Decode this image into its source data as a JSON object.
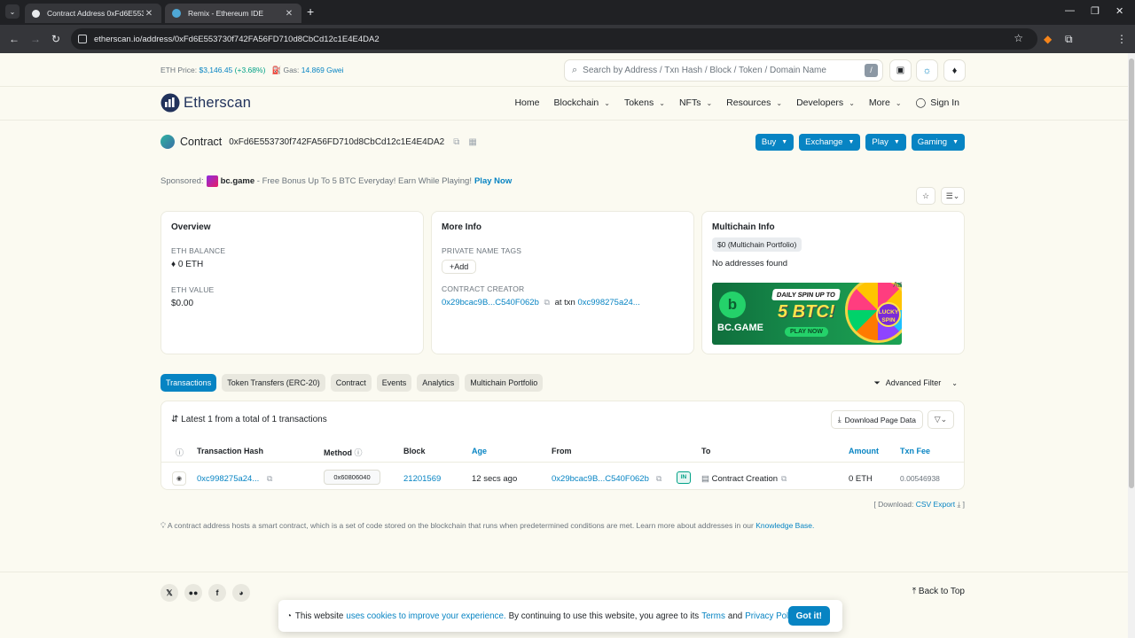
{
  "browser": {
    "tabs": [
      {
        "title": "Contract Address 0xFd6E55373",
        "active": true
      },
      {
        "title": "Remix - Ethereum IDE",
        "active": false
      }
    ],
    "url": "etherscan.io/address/0xFd6E553730f742FA56FD710d8CbCd12c1E4E4DA2"
  },
  "topbar": {
    "eth_price_label": "ETH Price:",
    "eth_price": "$3,146.45",
    "eth_change": "(+3.68%)",
    "gas_label": "Gas:",
    "gas_value": "14.869 Gwei",
    "search_placeholder": "Search by Address / Txn Hash / Block / Token / Domain Name",
    "search_shortcut": "/"
  },
  "header": {
    "logo_text": "Etherscan",
    "nav": [
      "Home",
      "Blockchain",
      "Tokens",
      "NFTs",
      "Resources",
      "Developers",
      "More"
    ],
    "signin": "Sign In"
  },
  "contract": {
    "label": "Contract",
    "address": "0xFd6E553730f742FA56FD710d8CbCd12c1E4E4DA2",
    "actions": [
      "Buy",
      "Exchange",
      "Play",
      "Gaming"
    ]
  },
  "sponsored": {
    "label": "Sponsored:",
    "brand": "bc.game",
    "text": "- Free Bonus Up To 5 BTC Everyday! Earn While Playing!",
    "cta": "Play Now"
  },
  "overview": {
    "title": "Overview",
    "eth_balance_label": "ETH BALANCE",
    "eth_balance": "0 ETH",
    "eth_value_label": "ETH VALUE",
    "eth_value": "$0.00"
  },
  "more_info": {
    "title": "More Info",
    "private_tags_label": "PRIVATE NAME TAGS",
    "add_label": "Add",
    "creator_label": "CONTRACT CREATOR",
    "creator_address": "0x29bcac9B...C540F062b",
    "at_txn": "at txn",
    "creator_txn": "0xc998275a24..."
  },
  "multichain": {
    "title": "Multichain Info",
    "portfolio": "$0 (Multichain Portfolio)",
    "empty": "No addresses found",
    "ad": {
      "tag": "Ad",
      "brand": "BC.GAME",
      "headline": "DAILY SPIN UP TO",
      "amount": "5 BTC!",
      "cta": "PLAY NOW",
      "wheel_label": "LUCKY SPIN"
    }
  },
  "tabs": [
    "Transactions",
    "Token Transfers (ERC-20)",
    "Contract",
    "Events",
    "Analytics",
    "Multichain Portfolio"
  ],
  "advanced_filter": "Advanced Filter",
  "transactions": {
    "summary": "Latest 1 from a total of 1 transactions",
    "download": "Download Page Data",
    "columns": [
      "Transaction Hash",
      "Method",
      "Block",
      "Age",
      "From",
      "To",
      "Amount",
      "Txn Fee"
    ],
    "rows": [
      {
        "hash": "0xc998275a24...",
        "method": "0x60806040",
        "block": "21201569",
        "age": "12 secs ago",
        "from": "0x29bcac9B...C540F062b",
        "direction": "IN",
        "to": "Contract Creation",
        "amount": "0 ETH",
        "fee": "0.00546938"
      }
    ]
  },
  "csv": {
    "prefix": "[ Download:",
    "link": "CSV Export",
    "suffix": "]"
  },
  "note": {
    "text": "A contract address hosts a smart contract, which is a set of code stored on the blockchain that runs when predetermined conditions are met. Learn more about addresses in our",
    "link": "Knowledge Base."
  },
  "footer": {
    "back_to_top": "Back to Top"
  },
  "cookie": {
    "t1": "This website",
    "l1": "uses cookies to improve your experience.",
    "t2": "By continuing to use this website, you agree to its",
    "l2": "Terms",
    "t3": "and",
    "l3": "Privacy Policy.",
    "button": "Got it!"
  },
  "colors": {
    "accent": "#0784c3",
    "positive": "#00a186",
    "brand_navy": "#21325b"
  }
}
